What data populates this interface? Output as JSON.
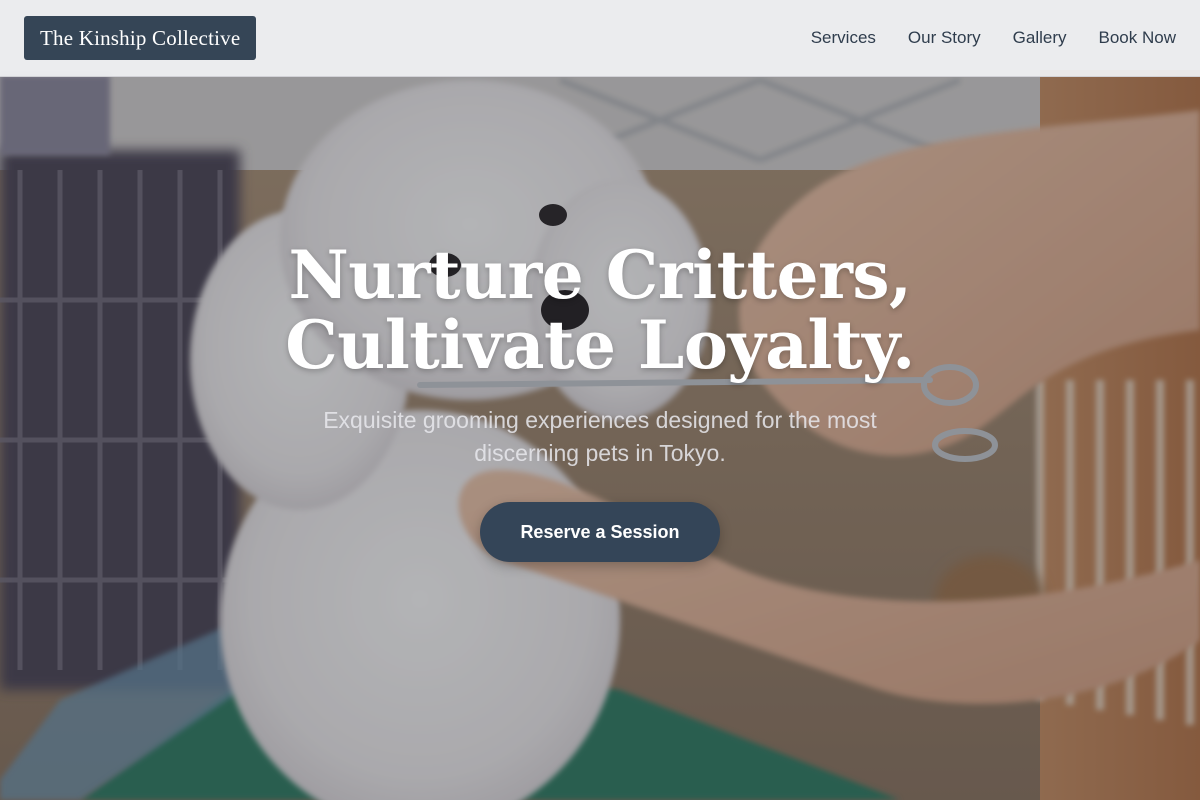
{
  "header": {
    "brand": "The Kinship Collective",
    "nav": [
      {
        "label": "Services"
      },
      {
        "label": "Our Story"
      },
      {
        "label": "Gallery"
      },
      {
        "label": "Book Now"
      }
    ]
  },
  "hero": {
    "title_line1": "Nurture Critters,",
    "title_line2": "Cultivate Loyalty.",
    "subtitle": "Exquisite grooming experiences designed for the most discerning pets in Tokyo.",
    "cta_label": "Reserve a Session",
    "photo_subject": "white poodle being groomed with scissors"
  },
  "colors": {
    "brand_bg": "#354556",
    "cta_bg": "#344558",
    "nav_text": "#2f3d4d",
    "header_bg": "#f1f2f4"
  }
}
